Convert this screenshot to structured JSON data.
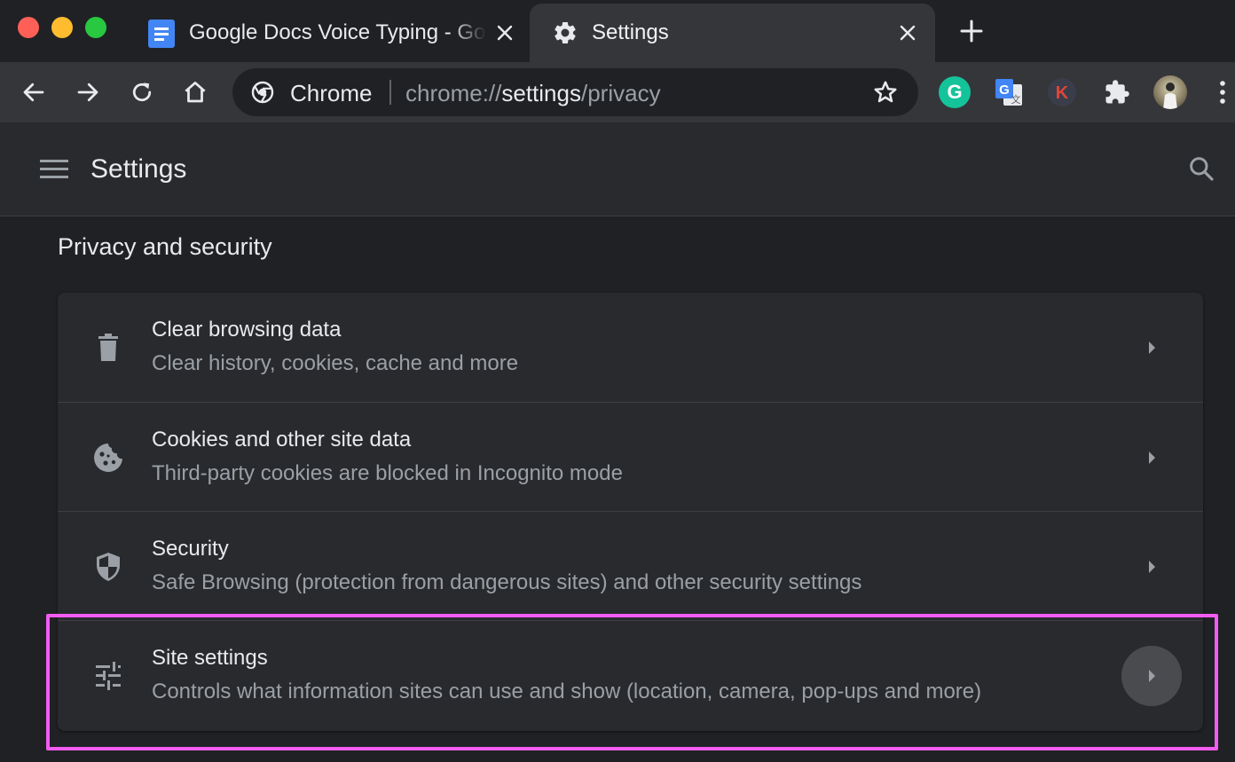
{
  "tabs": [
    {
      "title": "Google Docs Voice Typing - Google Docs",
      "icon": "google-docs-icon",
      "active": false
    },
    {
      "title": "Settings",
      "icon": "gear-icon",
      "active": true
    }
  ],
  "toolbar": {
    "omnibox": {
      "chip_label": "Chrome",
      "url_scheme": "chrome://",
      "url_host": "settings",
      "url_path": "/privacy"
    },
    "extensions": [
      {
        "name": "grammarly-icon",
        "label": "G"
      },
      {
        "name": "google-translate-icon",
        "label": ""
      },
      {
        "name": "k-extension-icon",
        "label": "K"
      },
      {
        "name": "puzzle-extensions-icon",
        "label": ""
      },
      {
        "name": "profile-avatar",
        "label": ""
      }
    ]
  },
  "header": {
    "title": "Settings"
  },
  "section": {
    "title": "Privacy and security",
    "items": [
      {
        "title": "Clear browsing data",
        "subtitle": "Clear history, cookies, cache and more",
        "icon": "trash-icon"
      },
      {
        "title": "Cookies and other site data",
        "subtitle": "Third-party cookies are blocked in Incognito mode",
        "icon": "cookie-icon"
      },
      {
        "title": "Security",
        "subtitle": "Safe Browsing (protection from dangerous sites) and other security settings",
        "icon": "shield-icon"
      },
      {
        "title": "Site settings",
        "subtitle": "Controls what information sites can use and show (location, camera, pop-ups and more)",
        "icon": "tune-sliders-icon"
      }
    ]
  },
  "colors": {
    "highlight": "#f25cf2",
    "page_background": "#202124",
    "card_background": "#292a2d"
  }
}
